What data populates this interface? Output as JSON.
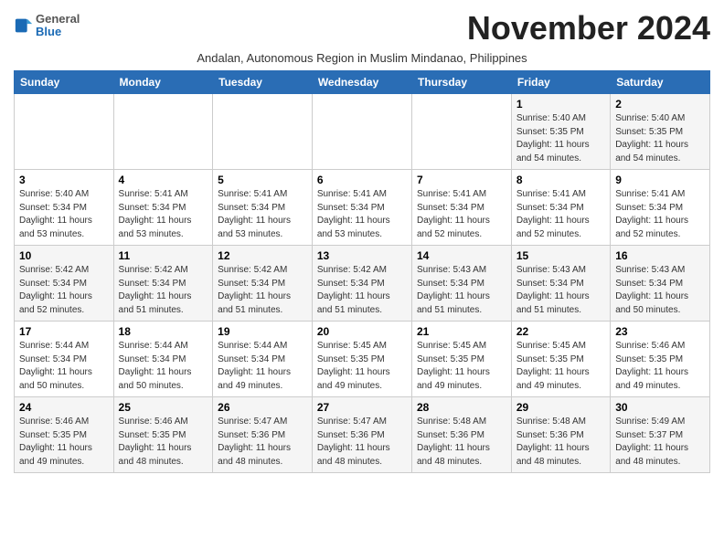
{
  "header": {
    "logo_general": "General",
    "logo_blue": "Blue",
    "month_title": "November 2024",
    "subtitle": "Andalan, Autonomous Region in Muslim Mindanao, Philippines"
  },
  "days_of_week": [
    "Sunday",
    "Monday",
    "Tuesday",
    "Wednesday",
    "Thursday",
    "Friday",
    "Saturday"
  ],
  "weeks": [
    [
      {
        "day": "",
        "info": ""
      },
      {
        "day": "",
        "info": ""
      },
      {
        "day": "",
        "info": ""
      },
      {
        "day": "",
        "info": ""
      },
      {
        "day": "",
        "info": ""
      },
      {
        "day": "1",
        "info": "Sunrise: 5:40 AM\nSunset: 5:35 PM\nDaylight: 11 hours and 54 minutes."
      },
      {
        "day": "2",
        "info": "Sunrise: 5:40 AM\nSunset: 5:35 PM\nDaylight: 11 hours and 54 minutes."
      }
    ],
    [
      {
        "day": "3",
        "info": "Sunrise: 5:40 AM\nSunset: 5:34 PM\nDaylight: 11 hours and 53 minutes."
      },
      {
        "day": "4",
        "info": "Sunrise: 5:41 AM\nSunset: 5:34 PM\nDaylight: 11 hours and 53 minutes."
      },
      {
        "day": "5",
        "info": "Sunrise: 5:41 AM\nSunset: 5:34 PM\nDaylight: 11 hours and 53 minutes."
      },
      {
        "day": "6",
        "info": "Sunrise: 5:41 AM\nSunset: 5:34 PM\nDaylight: 11 hours and 53 minutes."
      },
      {
        "day": "7",
        "info": "Sunrise: 5:41 AM\nSunset: 5:34 PM\nDaylight: 11 hours and 52 minutes."
      },
      {
        "day": "8",
        "info": "Sunrise: 5:41 AM\nSunset: 5:34 PM\nDaylight: 11 hours and 52 minutes."
      },
      {
        "day": "9",
        "info": "Sunrise: 5:41 AM\nSunset: 5:34 PM\nDaylight: 11 hours and 52 minutes."
      }
    ],
    [
      {
        "day": "10",
        "info": "Sunrise: 5:42 AM\nSunset: 5:34 PM\nDaylight: 11 hours and 52 minutes."
      },
      {
        "day": "11",
        "info": "Sunrise: 5:42 AM\nSunset: 5:34 PM\nDaylight: 11 hours and 51 minutes."
      },
      {
        "day": "12",
        "info": "Sunrise: 5:42 AM\nSunset: 5:34 PM\nDaylight: 11 hours and 51 minutes."
      },
      {
        "day": "13",
        "info": "Sunrise: 5:42 AM\nSunset: 5:34 PM\nDaylight: 11 hours and 51 minutes."
      },
      {
        "day": "14",
        "info": "Sunrise: 5:43 AM\nSunset: 5:34 PM\nDaylight: 11 hours and 51 minutes."
      },
      {
        "day": "15",
        "info": "Sunrise: 5:43 AM\nSunset: 5:34 PM\nDaylight: 11 hours and 51 minutes."
      },
      {
        "day": "16",
        "info": "Sunrise: 5:43 AM\nSunset: 5:34 PM\nDaylight: 11 hours and 50 minutes."
      }
    ],
    [
      {
        "day": "17",
        "info": "Sunrise: 5:44 AM\nSunset: 5:34 PM\nDaylight: 11 hours and 50 minutes."
      },
      {
        "day": "18",
        "info": "Sunrise: 5:44 AM\nSunset: 5:34 PM\nDaylight: 11 hours and 50 minutes."
      },
      {
        "day": "19",
        "info": "Sunrise: 5:44 AM\nSunset: 5:34 PM\nDaylight: 11 hours and 49 minutes."
      },
      {
        "day": "20",
        "info": "Sunrise: 5:45 AM\nSunset: 5:35 PM\nDaylight: 11 hours and 49 minutes."
      },
      {
        "day": "21",
        "info": "Sunrise: 5:45 AM\nSunset: 5:35 PM\nDaylight: 11 hours and 49 minutes."
      },
      {
        "day": "22",
        "info": "Sunrise: 5:45 AM\nSunset: 5:35 PM\nDaylight: 11 hours and 49 minutes."
      },
      {
        "day": "23",
        "info": "Sunrise: 5:46 AM\nSunset: 5:35 PM\nDaylight: 11 hours and 49 minutes."
      }
    ],
    [
      {
        "day": "24",
        "info": "Sunrise: 5:46 AM\nSunset: 5:35 PM\nDaylight: 11 hours and 49 minutes."
      },
      {
        "day": "25",
        "info": "Sunrise: 5:46 AM\nSunset: 5:35 PM\nDaylight: 11 hours and 48 minutes."
      },
      {
        "day": "26",
        "info": "Sunrise: 5:47 AM\nSunset: 5:36 PM\nDaylight: 11 hours and 48 minutes."
      },
      {
        "day": "27",
        "info": "Sunrise: 5:47 AM\nSunset: 5:36 PM\nDaylight: 11 hours and 48 minutes."
      },
      {
        "day": "28",
        "info": "Sunrise: 5:48 AM\nSunset: 5:36 PM\nDaylight: 11 hours and 48 minutes."
      },
      {
        "day": "29",
        "info": "Sunrise: 5:48 AM\nSunset: 5:36 PM\nDaylight: 11 hours and 48 minutes."
      },
      {
        "day": "30",
        "info": "Sunrise: 5:49 AM\nSunset: 5:37 PM\nDaylight: 11 hours and 48 minutes."
      }
    ]
  ]
}
